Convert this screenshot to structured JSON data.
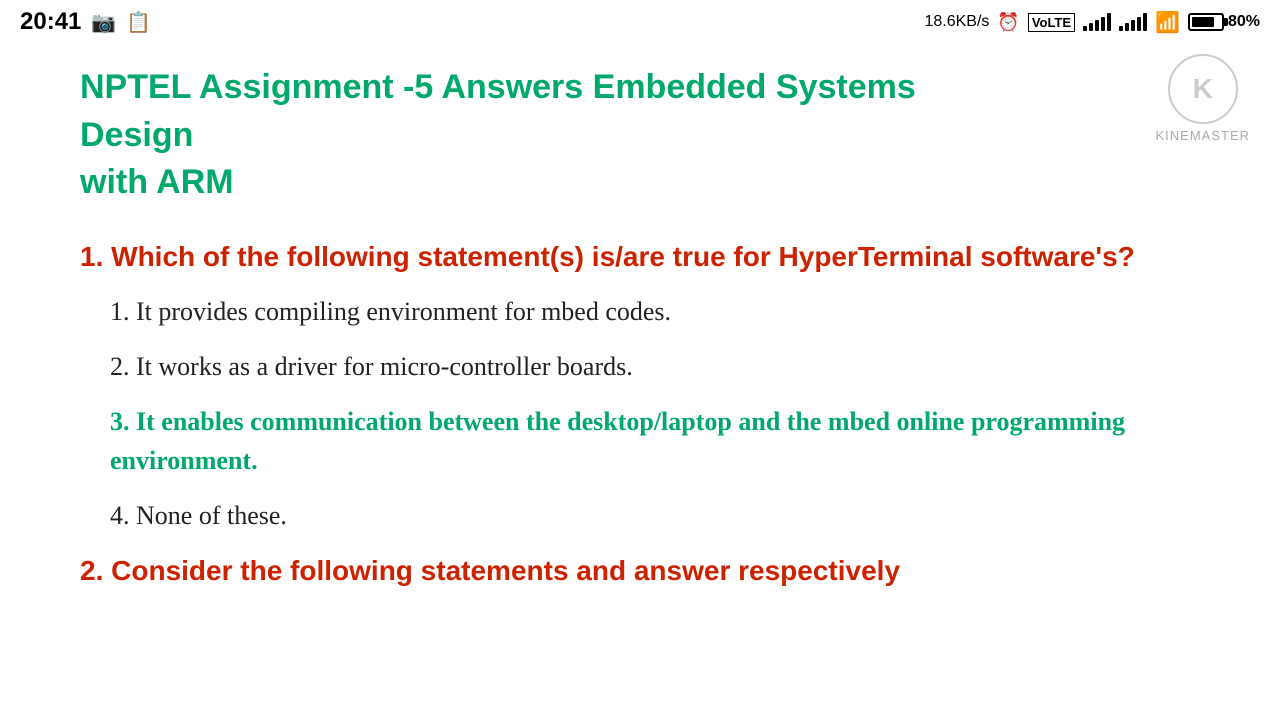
{
  "statusBar": {
    "time": "20:41",
    "speed": "18.6KB/s",
    "battery_percent": "80%"
  },
  "kinemaster": {
    "circle_text": "K",
    "label": "KINEMASTER"
  },
  "page": {
    "title_line1": "NPTEL Assignment -5 Answers Embedded Systems Design",
    "title_line2": "with ARM"
  },
  "questions": [
    {
      "number": "1.",
      "text": "Which of the following statement(s) is/are true for HyperTerminal software's?",
      "answers": [
        {
          "num": "1.",
          "text": "It provides compiling environment for mbed codes.",
          "highlighted": false
        },
        {
          "num": "2.",
          "text": "It works as a driver for micro-controller boards.",
          "highlighted": false
        },
        {
          "num": "3.",
          "text": "It enables communication between the desktop/laptop and the mbed online programming environment.",
          "highlighted": true
        },
        {
          "num": "4.",
          "text": "None of these.",
          "highlighted": false
        }
      ]
    }
  ],
  "partial_q2": {
    "number": "2.",
    "text": "Consider the following statements and answer respectively"
  }
}
